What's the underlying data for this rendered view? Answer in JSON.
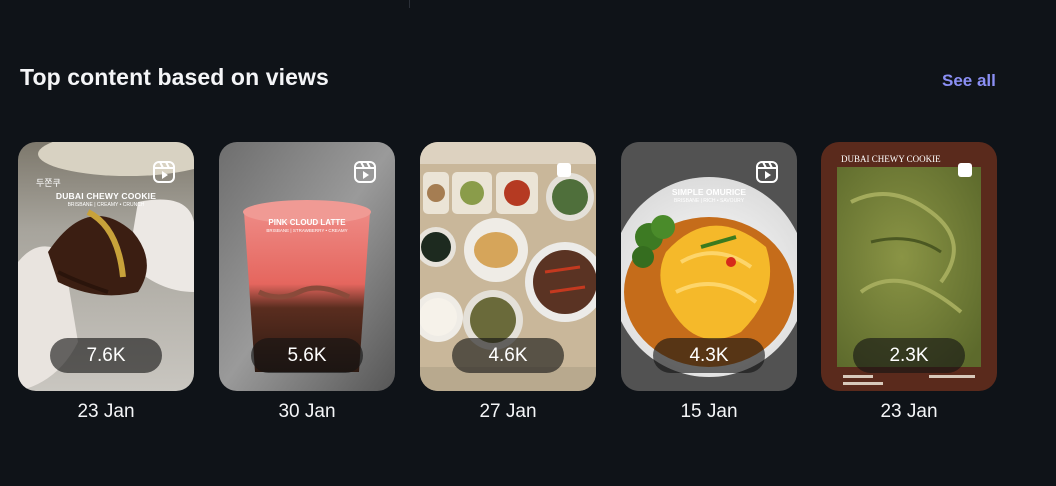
{
  "section": {
    "title": "Top content based on views",
    "see_all": "See all"
  },
  "cards": [
    {
      "views": "7.6K",
      "date": "23 Jan",
      "type_icon": "reel-icon",
      "overlay": {
        "title": "DUBAI CHEWY COOKIE",
        "subtitle": "BRISBANE | CREAMY • CRUNCH",
        "tag": "두쫀쿠"
      }
    },
    {
      "views": "5.6K",
      "date": "30 Jan",
      "type_icon": "reel-icon",
      "overlay": {
        "title": "PINK CLOUD LATTE",
        "subtitle": "BRISBANE | STRAWBERRY • CREAMY"
      }
    },
    {
      "views": "4.6K",
      "date": "27 Jan",
      "type_icon": "carousel-icon",
      "overlay": {}
    },
    {
      "views": "4.3K",
      "date": "15 Jan",
      "type_icon": "reel-icon",
      "overlay": {
        "title": "SIMPLE OMURICE",
        "subtitle": "BRISBANE | RICH • SAVOURY"
      }
    },
    {
      "views": "2.3K",
      "date": "23 Jan",
      "type_icon": "carousel-icon",
      "overlay": {
        "title": "DUBAI CHEWY COOKIE"
      }
    }
  ],
  "colors": {
    "background": "#0f1318",
    "accent_link": "#8b8ff4",
    "pill_background": "rgba(20,20,20,0.62)"
  }
}
